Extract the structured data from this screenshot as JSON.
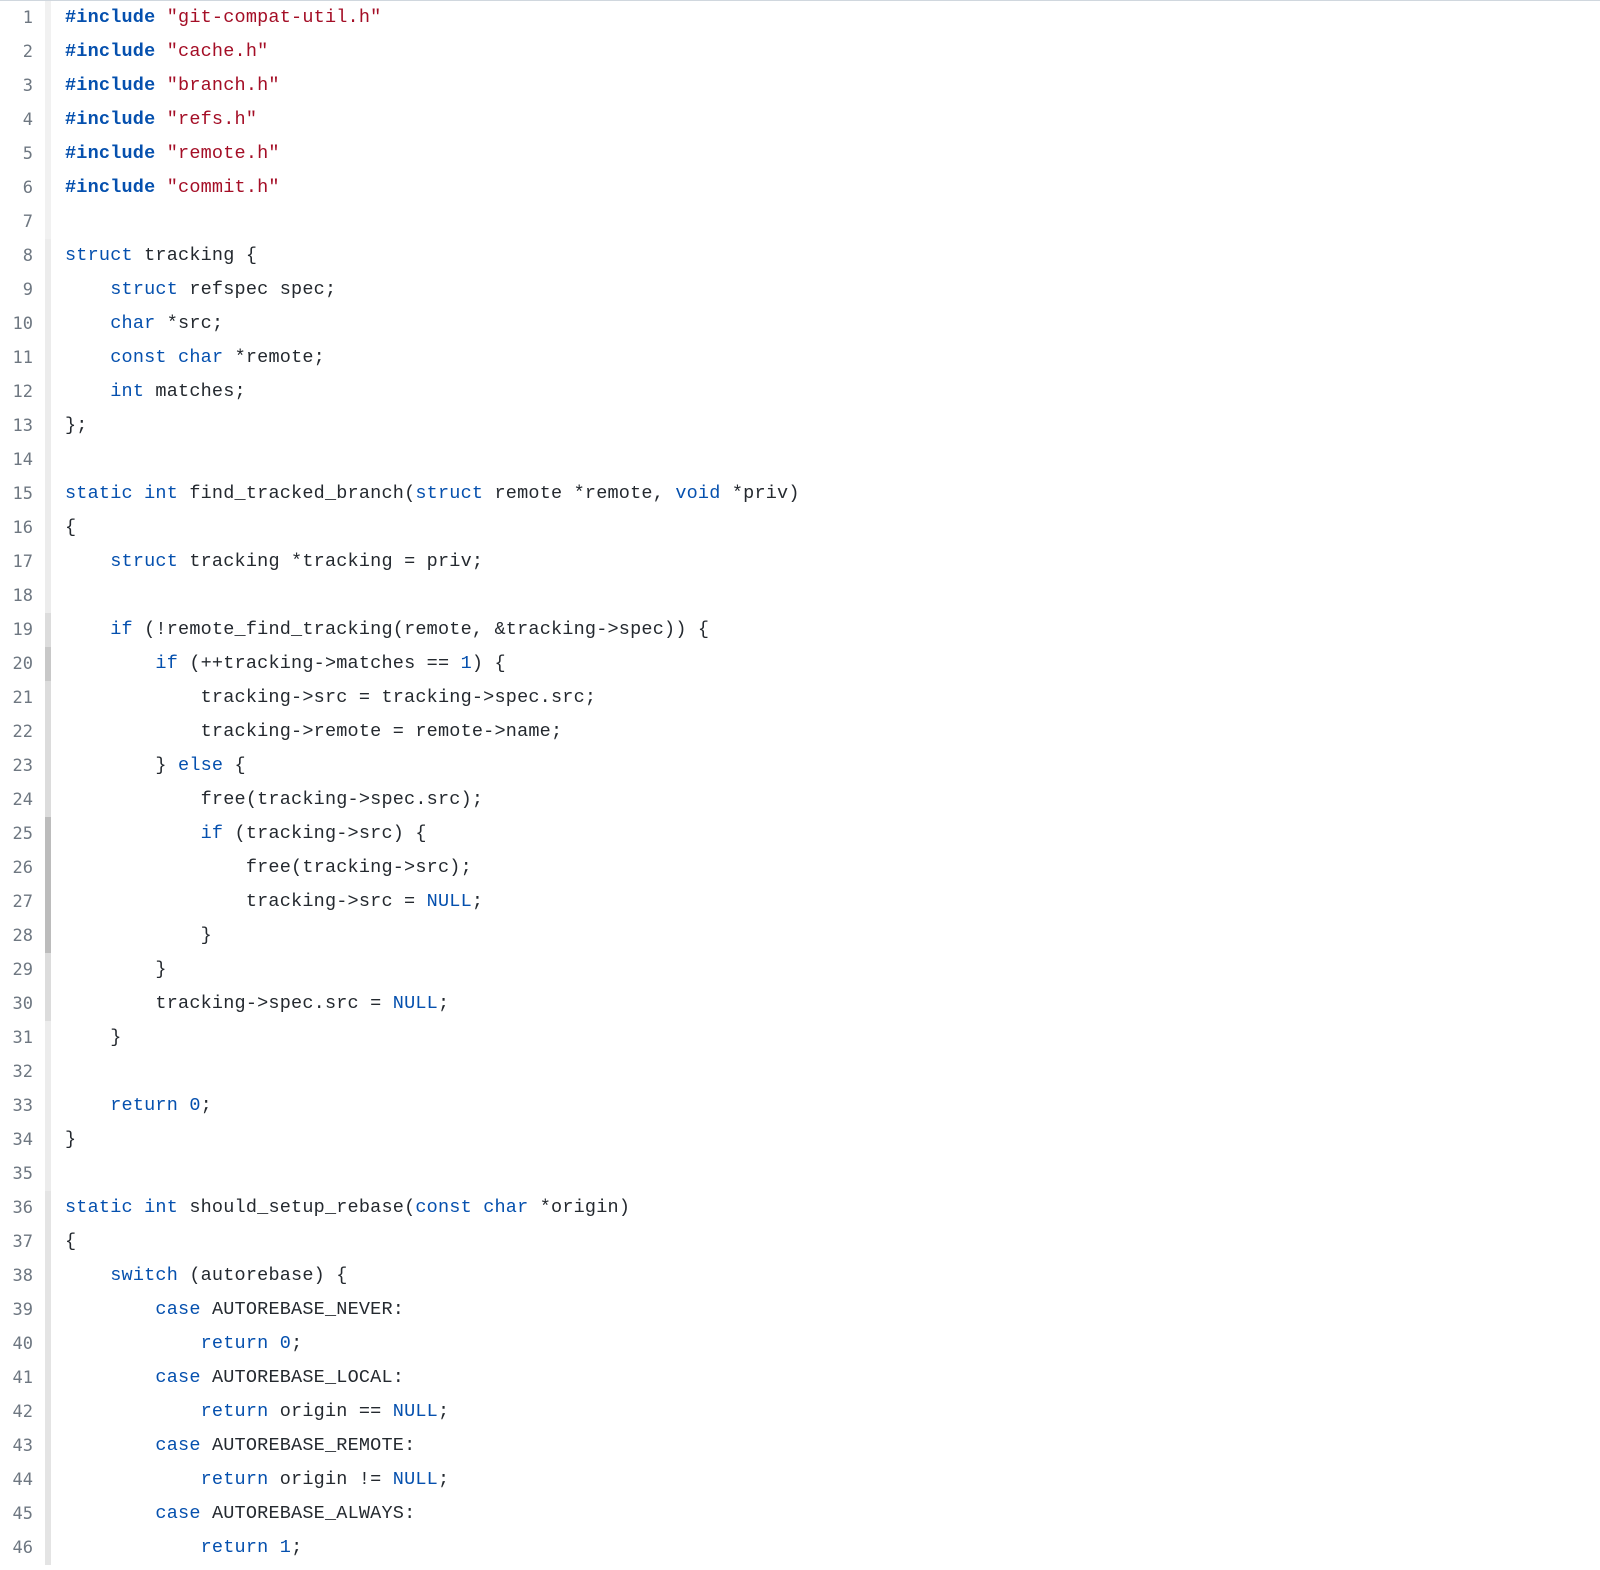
{
  "lines": [
    {
      "n": 1,
      "age": "age-a",
      "tokens": [
        [
          "pp",
          "#include "
        ],
        [
          "str",
          "\"git-compat-util.h\""
        ]
      ]
    },
    {
      "n": 2,
      "age": "age-a",
      "tokens": [
        [
          "pp",
          "#include "
        ],
        [
          "str",
          "\"cache.h\""
        ]
      ]
    },
    {
      "n": 3,
      "age": "age-a",
      "tokens": [
        [
          "pp",
          "#include "
        ],
        [
          "str",
          "\"branch.h\""
        ]
      ]
    },
    {
      "n": 4,
      "age": "age-a",
      "tokens": [
        [
          "pp",
          "#include "
        ],
        [
          "str",
          "\"refs.h\""
        ]
      ]
    },
    {
      "n": 5,
      "age": "age-a",
      "tokens": [
        [
          "pp",
          "#include "
        ],
        [
          "str",
          "\"remote.h\""
        ]
      ]
    },
    {
      "n": 6,
      "age": "age-a",
      "tokens": [
        [
          "pp",
          "#include "
        ],
        [
          "str",
          "\"commit.h\""
        ]
      ]
    },
    {
      "n": 7,
      "age": "age-a",
      "tokens": [
        [
          "plain",
          ""
        ]
      ]
    },
    {
      "n": 8,
      "age": "age-b",
      "tokens": [
        [
          "kw",
          "struct"
        ],
        [
          "plain",
          " tracking {"
        ]
      ]
    },
    {
      "n": 9,
      "age": "age-b",
      "tokens": [
        [
          "plain",
          "    "
        ],
        [
          "kw",
          "struct"
        ],
        [
          "plain",
          " refspec spec;"
        ]
      ]
    },
    {
      "n": 10,
      "age": "age-b",
      "tokens": [
        [
          "plain",
          "    "
        ],
        [
          "kw",
          "char"
        ],
        [
          "plain",
          " *src;"
        ]
      ]
    },
    {
      "n": 11,
      "age": "age-b",
      "tokens": [
        [
          "plain",
          "    "
        ],
        [
          "kw",
          "const"
        ],
        [
          "plain",
          " "
        ],
        [
          "kw",
          "char"
        ],
        [
          "plain",
          " *remote;"
        ]
      ]
    },
    {
      "n": 12,
      "age": "age-b",
      "tokens": [
        [
          "plain",
          "    "
        ],
        [
          "kw",
          "int"
        ],
        [
          "plain",
          " matches;"
        ]
      ]
    },
    {
      "n": 13,
      "age": "age-b",
      "tokens": [
        [
          "plain",
          "};"
        ]
      ]
    },
    {
      "n": 14,
      "age": "age-b",
      "tokens": [
        [
          "plain",
          ""
        ]
      ]
    },
    {
      "n": 15,
      "age": "age-b",
      "tokens": [
        [
          "kw",
          "static"
        ],
        [
          "plain",
          " "
        ],
        [
          "kw",
          "int"
        ],
        [
          "plain",
          " find_tracked_branch("
        ],
        [
          "kw",
          "struct"
        ],
        [
          "plain",
          " remote *remote, "
        ],
        [
          "kw",
          "void"
        ],
        [
          "plain",
          " *priv)"
        ]
      ]
    },
    {
      "n": 16,
      "age": "age-b",
      "tokens": [
        [
          "plain",
          "{"
        ]
      ]
    },
    {
      "n": 17,
      "age": "age-b",
      "tokens": [
        [
          "plain",
          "    "
        ],
        [
          "kw",
          "struct"
        ],
        [
          "plain",
          " tracking *tracking = priv;"
        ]
      ]
    },
    {
      "n": 18,
      "age": "age-b",
      "tokens": [
        [
          "plain",
          ""
        ]
      ]
    },
    {
      "n": 19,
      "age": "age-d",
      "tokens": [
        [
          "plain",
          "    "
        ],
        [
          "kw",
          "if"
        ],
        [
          "plain",
          " (!remote_find_tracking(remote, &tracking->spec)) {"
        ]
      ]
    },
    {
      "n": 20,
      "age": "age-f",
      "tokens": [
        [
          "plain",
          "        "
        ],
        [
          "kw",
          "if"
        ],
        [
          "plain",
          " (++tracking->matches == "
        ],
        [
          "num",
          "1"
        ],
        [
          "plain",
          ") {"
        ]
      ]
    },
    {
      "n": 21,
      "age": "age-d",
      "tokens": [
        [
          "plain",
          "            tracking->src = tracking->spec.src;"
        ]
      ]
    },
    {
      "n": 22,
      "age": "age-d",
      "tokens": [
        [
          "plain",
          "            tracking->remote = remote->name;"
        ]
      ]
    },
    {
      "n": 23,
      "age": "age-d",
      "tokens": [
        [
          "plain",
          "        } "
        ],
        [
          "kw",
          "else"
        ],
        [
          "plain",
          " {"
        ]
      ]
    },
    {
      "n": 24,
      "age": "age-d",
      "tokens": [
        [
          "plain",
          "            free(tracking->spec.src);"
        ]
      ]
    },
    {
      "n": 25,
      "age": "age-g",
      "tokens": [
        [
          "plain",
          "            "
        ],
        [
          "kw",
          "if"
        ],
        [
          "plain",
          " (tracking->src) {"
        ]
      ]
    },
    {
      "n": 26,
      "age": "age-g",
      "tokens": [
        [
          "plain",
          "                free(tracking->src);"
        ]
      ]
    },
    {
      "n": 27,
      "age": "age-g",
      "tokens": [
        [
          "plain",
          "                tracking->src = "
        ],
        [
          "const",
          "NULL"
        ],
        [
          "plain",
          ";"
        ]
      ]
    },
    {
      "n": 28,
      "age": "age-g",
      "tokens": [
        [
          "plain",
          "            }"
        ]
      ]
    },
    {
      "n": 29,
      "age": "age-d",
      "tokens": [
        [
          "plain",
          "        }"
        ]
      ]
    },
    {
      "n": 30,
      "age": "age-d",
      "tokens": [
        [
          "plain",
          "        tracking->spec.src = "
        ],
        [
          "const",
          "NULL"
        ],
        [
          "plain",
          ";"
        ]
      ]
    },
    {
      "n": 31,
      "age": "age-b",
      "tokens": [
        [
          "plain",
          "    }"
        ]
      ]
    },
    {
      "n": 32,
      "age": "age-b",
      "tokens": [
        [
          "plain",
          ""
        ]
      ]
    },
    {
      "n": 33,
      "age": "age-b",
      "tokens": [
        [
          "plain",
          "    "
        ],
        [
          "kw",
          "return"
        ],
        [
          "plain",
          " "
        ],
        [
          "num",
          "0"
        ],
        [
          "plain",
          ";"
        ]
      ]
    },
    {
      "n": 34,
      "age": "age-b",
      "tokens": [
        [
          "plain",
          "}"
        ]
      ]
    },
    {
      "n": 35,
      "age": "age-b",
      "tokens": [
        [
          "plain",
          ""
        ]
      ]
    },
    {
      "n": 36,
      "age": "age-c",
      "tokens": [
        [
          "kw",
          "static"
        ],
        [
          "plain",
          " "
        ],
        [
          "kw",
          "int"
        ],
        [
          "plain",
          " should_setup_rebase("
        ],
        [
          "kw",
          "const"
        ],
        [
          "plain",
          " "
        ],
        [
          "kw",
          "char"
        ],
        [
          "plain",
          " *origin)"
        ]
      ]
    },
    {
      "n": 37,
      "age": "age-c",
      "tokens": [
        [
          "plain",
          "{"
        ]
      ]
    },
    {
      "n": 38,
      "age": "age-c",
      "tokens": [
        [
          "plain",
          "    "
        ],
        [
          "kw",
          "switch"
        ],
        [
          "plain",
          " (autorebase) {"
        ]
      ]
    },
    {
      "n": 39,
      "age": "age-c",
      "tokens": [
        [
          "plain",
          "        "
        ],
        [
          "kw",
          "case"
        ],
        [
          "plain",
          " AUTOREBASE_NEVER:"
        ]
      ]
    },
    {
      "n": 40,
      "age": "age-c",
      "tokens": [
        [
          "plain",
          "            "
        ],
        [
          "kw",
          "return"
        ],
        [
          "plain",
          " "
        ],
        [
          "num",
          "0"
        ],
        [
          "plain",
          ";"
        ]
      ]
    },
    {
      "n": 41,
      "age": "age-c",
      "tokens": [
        [
          "plain",
          "        "
        ],
        [
          "kw",
          "case"
        ],
        [
          "plain",
          " AUTOREBASE_LOCAL:"
        ]
      ]
    },
    {
      "n": 42,
      "age": "age-c",
      "tokens": [
        [
          "plain",
          "            "
        ],
        [
          "kw",
          "return"
        ],
        [
          "plain",
          " origin == "
        ],
        [
          "const",
          "NULL"
        ],
        [
          "plain",
          ";"
        ]
      ]
    },
    {
      "n": 43,
      "age": "age-c",
      "tokens": [
        [
          "plain",
          "        "
        ],
        [
          "kw",
          "case"
        ],
        [
          "plain",
          " AUTOREBASE_REMOTE:"
        ]
      ]
    },
    {
      "n": 44,
      "age": "age-c",
      "tokens": [
        [
          "plain",
          "            "
        ],
        [
          "kw",
          "return"
        ],
        [
          "plain",
          " origin != "
        ],
        [
          "const",
          "NULL"
        ],
        [
          "plain",
          ";"
        ]
      ]
    },
    {
      "n": 45,
      "age": "age-c",
      "tokens": [
        [
          "plain",
          "        "
        ],
        [
          "kw",
          "case"
        ],
        [
          "plain",
          " AUTOREBASE_ALWAYS:"
        ]
      ]
    },
    {
      "n": 46,
      "age": "age-c",
      "tokens": [
        [
          "plain",
          "            "
        ],
        [
          "kw",
          "return"
        ],
        [
          "plain",
          " "
        ],
        [
          "num",
          "1"
        ],
        [
          "plain",
          ";"
        ]
      ]
    }
  ]
}
